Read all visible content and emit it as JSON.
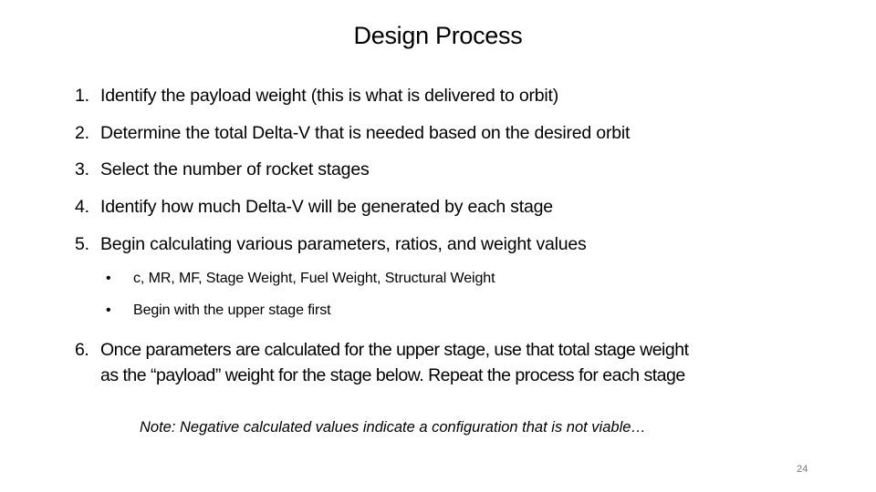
{
  "slide": {
    "title": "Design Process",
    "steps": [
      {
        "number": "1.",
        "text": "Identify the payload weight (this is what is delivered to orbit)"
      },
      {
        "number": "2.",
        "text": "Determine the total Delta-V that is needed based on the desired orbit"
      },
      {
        "number": "3.",
        "text": "Select the number of rocket stages"
      },
      {
        "number": "4.",
        "text": "Identify how much Delta-V will be generated by each stage"
      },
      {
        "number": "5.",
        "text": "Begin calculating various parameters, ratios, and weight values"
      }
    ],
    "sub_bullets": [
      {
        "bullet": "•",
        "text": "c, MR, MF, Stage Weight, Fuel Weight, Structural Weight"
      },
      {
        "bullet": "•",
        "text": "Begin with the upper stage first"
      }
    ],
    "step6": {
      "number": "6.",
      "line1": "Once parameters are calculated for the upper stage, use that total stage weight",
      "line2": "as the “payload” weight for the stage below.  Repeat the process for each stage"
    },
    "note": "Note:  Negative calculated values indicate a configuration that is not viable…",
    "page_number": "24"
  }
}
